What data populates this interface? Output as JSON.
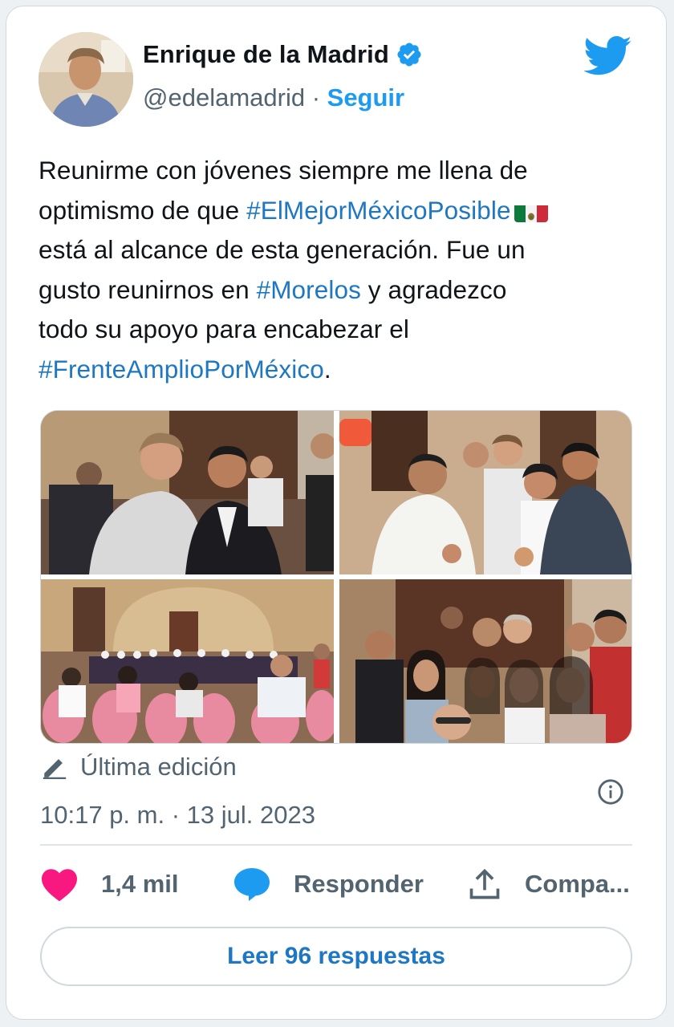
{
  "author": {
    "name": "Enrique de la Madrid",
    "handle": "@edelamadrid",
    "separator": " · ",
    "follow_label": "Seguir",
    "verified": true
  },
  "tweet": {
    "line1": "Reunirme con jóvenes siempre me llena de",
    "line2_pre": "optimismo de que ",
    "hashtag1": "#ElMejorMéxicoPosible",
    "flag_emoji": "🇲🇽",
    "line3": "está al alcance de esta generación. Fue un",
    "line4_pre": "gusto reunirnos en ",
    "hashtag2": "#Morelos",
    "line4_post": " y agradezco",
    "line5": "todo su apoyo para encabezar el",
    "hashtag3": "#FrenteAmplioPorMéxico",
    "line6_post": "."
  },
  "photos": [
    {
      "name": "photo-two-men-portrait"
    },
    {
      "name": "photo-group-selfie"
    },
    {
      "name": "photo-meeting-hall"
    },
    {
      "name": "photo-group-portrait"
    }
  ],
  "meta": {
    "edited_label": "Última edición",
    "timestamp": "10:17 p. m. · 13 jul. 2023"
  },
  "actions": {
    "likes": "1,4 mil",
    "reply": "Responder",
    "share": "Compa..."
  },
  "replies_button": "Leer 96 respuestas",
  "colors": {
    "accent": "#1d9bf0",
    "link": "#1d77c2",
    "like": "#f91880",
    "muted": "#536471"
  }
}
